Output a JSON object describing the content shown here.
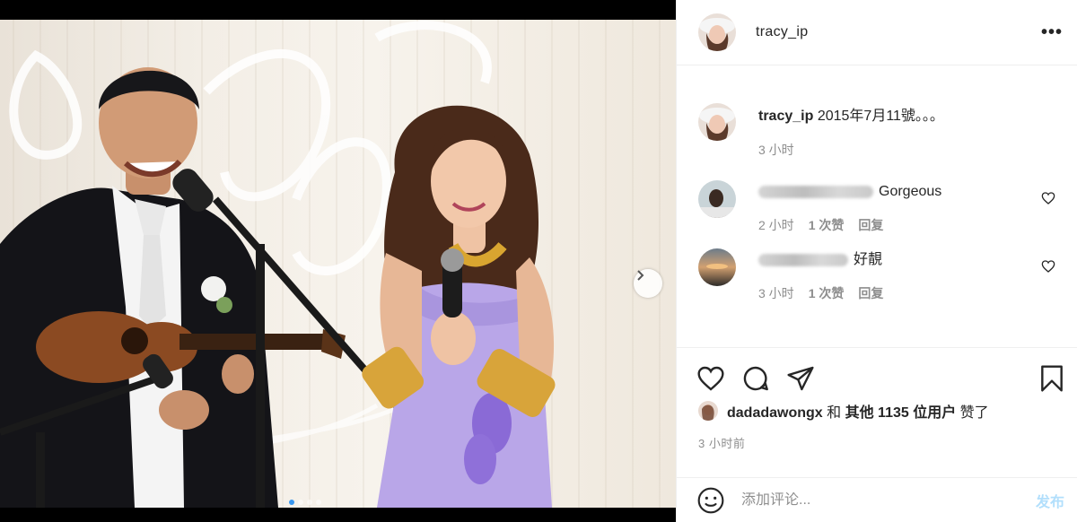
{
  "post": {
    "username": "tracy_ip",
    "caption": "2015年7月11號。。。",
    "caption_time": "3 小时",
    "photo_alt": "",
    "carousel": {
      "count": 4,
      "active": 0
    }
  },
  "comments": [
    {
      "visible_text": "Gorgeous",
      "time": "2 小时",
      "likes": "1 次赞",
      "reply": "回复"
    },
    {
      "visible_text": "好靚",
      "time": "3 小时",
      "likes": "1 次赞",
      "reply": "回复"
    }
  ],
  "likes": {
    "user": "dadadawongx",
    "conj": "和",
    "others": "其他 1135 位用户",
    "suffix": "赞了"
  },
  "time_ago": "3 小时前",
  "add_comment": {
    "placeholder": "添加评论...",
    "post_label": "发布"
  },
  "icons": {
    "more": "more-options-icon",
    "like": "heart-icon",
    "comment": "comment-icon",
    "share": "share-icon",
    "save": "bookmark-icon",
    "emoji": "emoji-icon",
    "next": "chevron-right-icon"
  },
  "colors": {
    "link_blue": "#b2dffc",
    "secondary_text": "#8e8e8e",
    "carousel_active": "#3897f0"
  }
}
